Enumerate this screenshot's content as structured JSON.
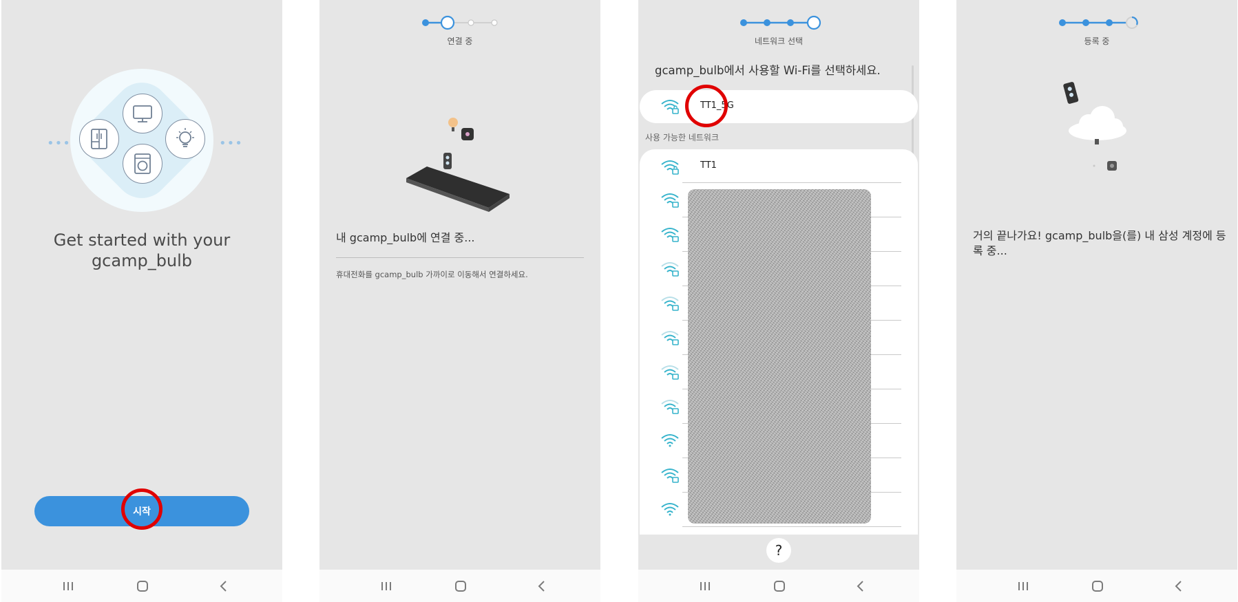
{
  "screen1": {
    "title_line1": "Get started with your",
    "title_line2": "gcamp_bulb",
    "start_button": "시작",
    "dots_left": "•••",
    "dots_right": "•••"
  },
  "screen2": {
    "step_label": "연결 중",
    "message": "내 gcamp_bulb에 연결 중...",
    "hint": "휴대전화를 gcamp_bulb 가까이로 이동해서 연결하세요."
  },
  "screen3": {
    "step_label": "네트워크 선택",
    "header": "gcamp_bulb에서 사용할 Wi-Fi를 선택하세요.",
    "selected_network": "TT1_5G",
    "available_label": "사용 가능한 네트워크",
    "first_network": "TT1",
    "help_label": "?"
  },
  "screen4": {
    "step_label": "등록 중",
    "message": "거의 끝나가요! gcamp_bulb을(를) 내 삼성 계정에 등록 중..."
  },
  "colors": {
    "accent": "#3b92dd",
    "wifi": "#37b4cc",
    "highlight": "#e00000"
  }
}
